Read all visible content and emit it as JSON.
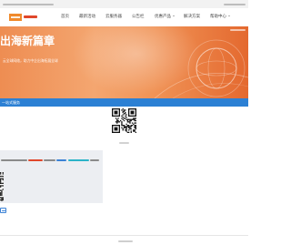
{
  "header": {
    "logo_icon": "company-logo",
    "nav": [
      {
        "label": "首页"
      },
      {
        "label": "最新活动"
      },
      {
        "label": "云服务器"
      },
      {
        "label": "公告栏"
      },
      {
        "label": "优惠产品",
        "icon": "chevron-down-icon"
      },
      {
        "label": "解决方案"
      },
      {
        "label": "帮助中心",
        "icon": "chevron-down-icon"
      }
    ]
  },
  "banner": {
    "title": "出海新篇章",
    "subtitle": "云全球网络，助力中企出海拓展全球",
    "decoration_icon": "globe-icon"
  },
  "section_bar": {
    "title": "一站式服务"
  },
  "qr_code_icon": "qr-code-icon",
  "colors": {
    "brand_orange": "#f08a2c",
    "banner_left": "#ee8d52",
    "banner_right": "#e4692f",
    "section_blue": "#2c80d4",
    "notice_bg": "#eceef2",
    "highlight_red": "#e0472b",
    "highlight_blue": "#3b82d6",
    "highlight_cyan": "#2bb3c8"
  }
}
